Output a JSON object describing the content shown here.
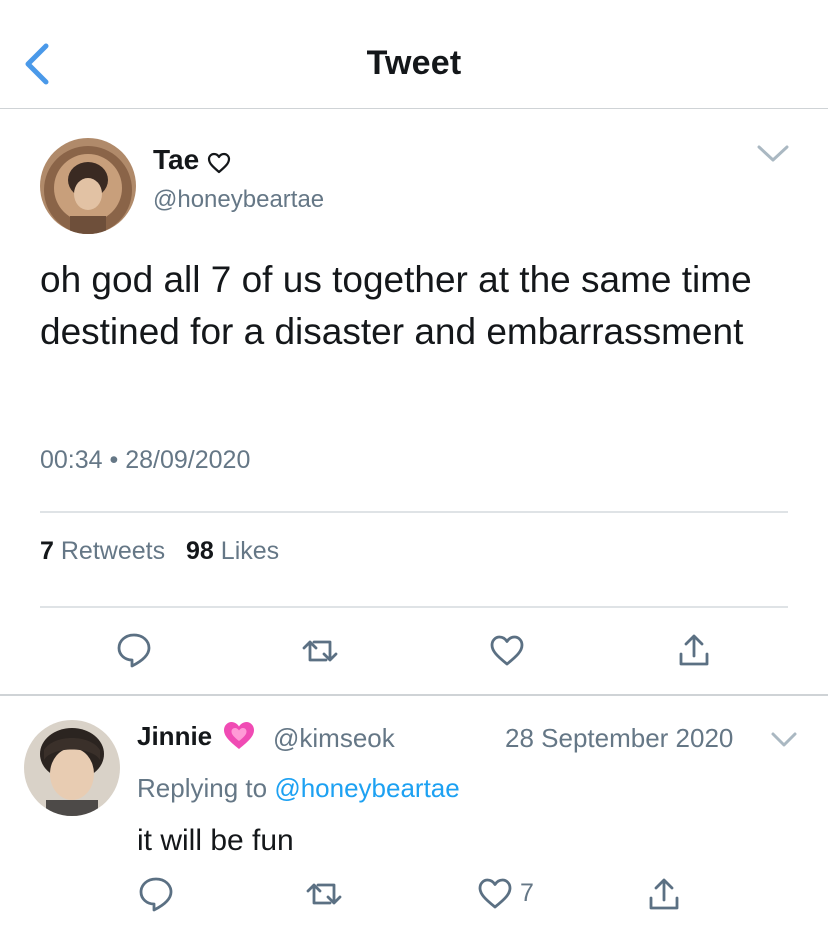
{
  "header": {
    "title": "Tweet",
    "back_icon": "chevron-left-icon"
  },
  "tweet": {
    "author_name": "Tae",
    "author_handle": "@honeybeartae",
    "text": "oh god all 7 of us together at the same time destined for a disaster and embarrassment",
    "time": "00:34",
    "separator": "•",
    "date": "28/09/2020",
    "retweets_count": "7",
    "retweets_label": "Retweets",
    "likes_count": "98",
    "likes_label": "Likes"
  },
  "reply": {
    "author_name": "Jinnie",
    "author_handle": "@kimseok",
    "date": "28 September 2020",
    "replying_label": "Replying to",
    "replying_to": "@honeybeartae",
    "text": "it will be fun",
    "like_count": "7"
  },
  "colors": {
    "accent": "#1da1f2",
    "secondary_text": "#657786",
    "action_icon": "#5b7083",
    "back_chevron": "#4a99e9",
    "heart_emoji": "#f04bb4"
  }
}
